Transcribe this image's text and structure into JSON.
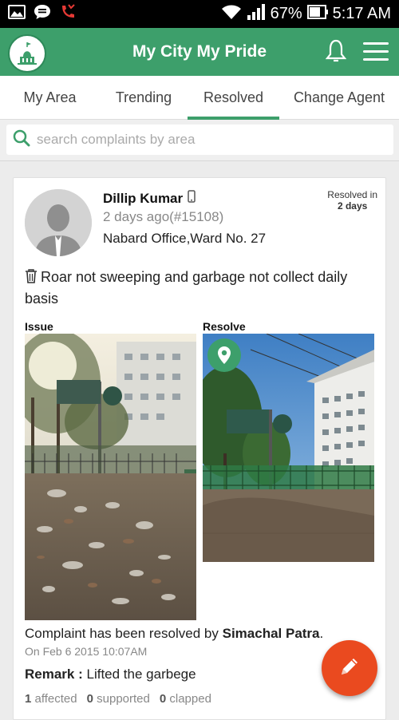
{
  "status_bar": {
    "battery": "67%",
    "time": "5:17 AM",
    "icons": [
      "image-icon",
      "chat-icon",
      "missed-call-icon",
      "wifi-icon",
      "signal-icon",
      "battery-icon"
    ]
  },
  "app_bar": {
    "title": "My City My Pride",
    "icons": [
      "city-logo-icon",
      "bell-icon",
      "menu-icon"
    ]
  },
  "tabs": [
    {
      "label": "My Area"
    },
    {
      "label": "Trending"
    },
    {
      "label": "Resolved",
      "active": true
    },
    {
      "label": "Change Agent"
    }
  ],
  "search": {
    "placeholder": "search complaints by area"
  },
  "complaint": {
    "user_name": "Dillip Kumar",
    "time_and_id": "2 days ago(#15108)",
    "location": "Nabard Office,Ward No. 27",
    "resolved_in_label": "Resolved in",
    "resolved_in_days": "2 days",
    "description": "Roar not sweeping and garbage not collect daily basis",
    "issue_label": "Issue",
    "resolve_label": "Resolve",
    "resolved_by_prefix": "Complaint has been resolved by",
    "resolved_by_name": "Simachal Patra",
    "resolved_by_suffix": ".",
    "resolved_date": "On Feb 6 2015 10:07AM",
    "remark_label": "Remark :",
    "remark_text": "Lifted the garbege",
    "affected_count": "1",
    "affected_label": "affected",
    "supported_count": "0",
    "supported_label": "supported",
    "clapped_count": "0",
    "clapped_label": "clapped"
  },
  "colors": {
    "primary": "#3d9f6b",
    "fab": "#ea4a1f"
  }
}
